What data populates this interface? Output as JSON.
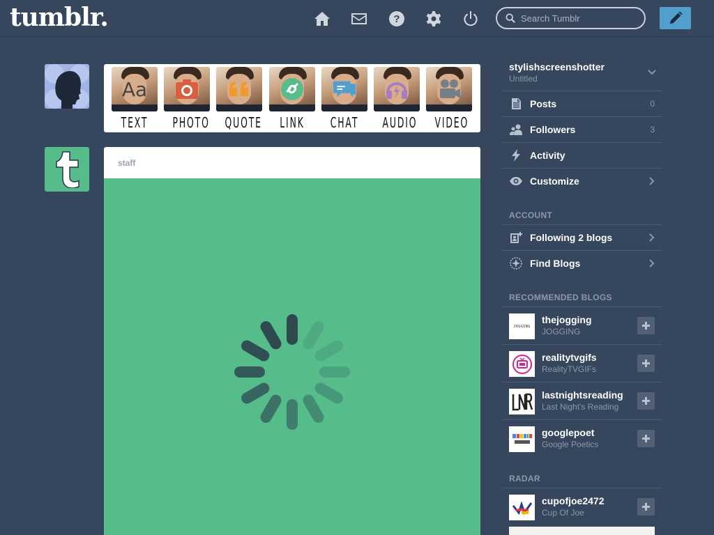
{
  "header": {
    "logo": "tumblr.",
    "search_placeholder": "Search Tumblr",
    "icons": [
      "home-icon",
      "mail-icon",
      "help-icon",
      "gear-icon",
      "power-icon"
    ]
  },
  "post_types": [
    {
      "label": "TEXT",
      "glyph": "Aa",
      "color": "#444444"
    },
    {
      "label": "PHOTO",
      "glyph": "camera",
      "color": "#d95e40"
    },
    {
      "label": "QUOTE",
      "glyph": "quote",
      "color": "#f2992e"
    },
    {
      "label": "LINK",
      "glyph": "link",
      "color": "#56bc8a"
    },
    {
      "label": "CHAT",
      "glyph": "chat",
      "color": "#529ecc"
    },
    {
      "label": "AUDIO",
      "glyph": "headphones",
      "color": "#a77dc2"
    },
    {
      "label": "VIDEO",
      "glyph": "video",
      "color": "#748089"
    }
  ],
  "post": {
    "author": "staff",
    "bg_color": "#56bc8a"
  },
  "sidebar": {
    "blog_name": "stylishscreenshotter",
    "blog_title": "Untitled",
    "nav": [
      {
        "label": "Posts",
        "count": "0",
        "icon": "posts-icon"
      },
      {
        "label": "Followers",
        "count": "3",
        "icon": "followers-icon"
      },
      {
        "label": "Activity",
        "count": "",
        "icon": "activity-icon"
      },
      {
        "label": "Customize",
        "count": "",
        "icon": "eye-icon"
      }
    ],
    "account_label": "ACCOUNT",
    "account": [
      {
        "label": "Following 2 blogs",
        "icon": "following-icon"
      },
      {
        "label": "Find Blogs",
        "icon": "find-blogs-icon"
      }
    ],
    "recommended_label": "RECOMMENDED BLOGS",
    "recommended": [
      {
        "name": "thejogging",
        "title": "JOGGING"
      },
      {
        "name": "realitytvgifs",
        "title": "RealityTVGIFs"
      },
      {
        "name": "lastnightsreading",
        "title": "Last Night's Reading"
      },
      {
        "name": "googlepoet",
        "title": "Google Poetics"
      }
    ],
    "radar_label": "RADAR",
    "radar": {
      "name": "cupofjoe2472",
      "title": "Cup Of Joe"
    }
  },
  "colors": {
    "background": "#36465d",
    "accent": "#529ecc",
    "green": "#56bc8a",
    "muted": "#8b98a8"
  }
}
